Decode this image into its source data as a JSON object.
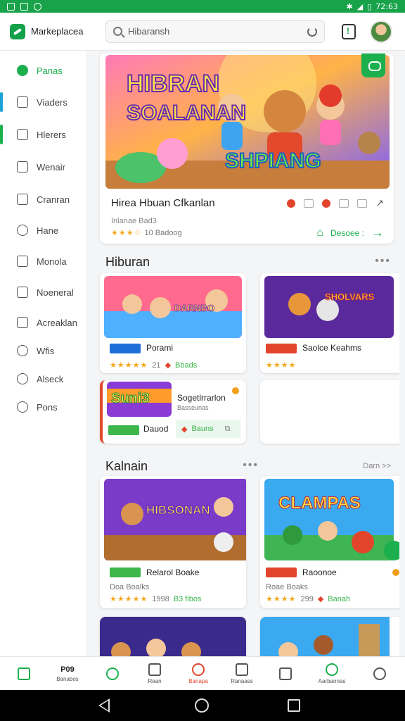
{
  "status_bar": {
    "time": "72:63",
    "icons": [
      "bluetooth-icon",
      "signal-icon",
      "battery-icon"
    ]
  },
  "header": {
    "brand": "Markeplacea",
    "search_value": "Hibaransh",
    "accent": "#15a04a"
  },
  "sidebar": {
    "items": [
      {
        "label": "Panas",
        "icon": "chat-icon",
        "active": true
      },
      {
        "label": "Viaders",
        "icon": "document-icon"
      },
      {
        "label": "Hlerers",
        "icon": "layers-icon"
      },
      {
        "label": "Wenair",
        "icon": "home-icon"
      },
      {
        "label": "Cranran",
        "icon": "book-icon"
      },
      {
        "label": "Hane",
        "icon": "store-icon"
      },
      {
        "label": "Monola",
        "icon": "cube-icon"
      },
      {
        "label": "Noeneral",
        "icon": "list-icon"
      },
      {
        "label": "Acreaklan",
        "icon": "folder-icon"
      },
      {
        "label": "Wfis",
        "icon": "pen-icon"
      },
      {
        "label": "Alseck",
        "icon": "music-icon"
      },
      {
        "label": "Pons",
        "icon": "clock-icon"
      }
    ]
  },
  "hero": {
    "image_title_line1": "HIBRAN",
    "image_title_line2": "SOALANAN",
    "image_sub": "SHPIANG",
    "title": "Hirea Hbuan Cfkanlan",
    "subtitle": "Inlanae Bad3",
    "rating_count": "10 Badoog",
    "action": "Desoee :"
  },
  "sections": [
    {
      "title": "Hiburan",
      "cards": [
        {
          "name": "Porami",
          "meta": "21",
          "price": "Bbads",
          "img_text": "DARNBO"
        },
        {
          "name": "Saolce Keahms",
          "meta": "",
          "price": "",
          "img_text": "SHOLVARS"
        },
        {
          "name": "Sogetlrrarlon",
          "sub": "Basseunas",
          "price": "Bauns",
          "label2": "Dauod",
          "img_text": "Suni3"
        }
      ]
    },
    {
      "title": "Kalnain",
      "more": "Darn >>",
      "cards": [
        {
          "name": "Relarol Boake",
          "sub": "Doa Boalks",
          "meta": "1998",
          "price": "B3 fibos",
          "img_text": "HIBSONAN"
        },
        {
          "name": "Raoonoe",
          "sub": "Roae Boaks",
          "meta": "299",
          "price": "Banah",
          "img_text": "CLAMPAS"
        }
      ]
    }
  ],
  "bottom_nav": [
    {
      "label": "",
      "icon": "home-icon",
      "active": true
    },
    {
      "label": "P09",
      "sub": "Banabos",
      "icon": ""
    },
    {
      "label": "",
      "icon": "pencil-icon"
    },
    {
      "label": "Rean",
      "icon": "building-icon"
    },
    {
      "label": "Banapa",
      "icon": "game-icon"
    },
    {
      "label": "Ranaass",
      "icon": "card-icon"
    },
    {
      "label": "",
      "icon": "tool-icon"
    },
    {
      "label": "Aarbannas",
      "icon": "sparkle-icon"
    },
    {
      "label": "",
      "icon": "user-icon"
    }
  ]
}
